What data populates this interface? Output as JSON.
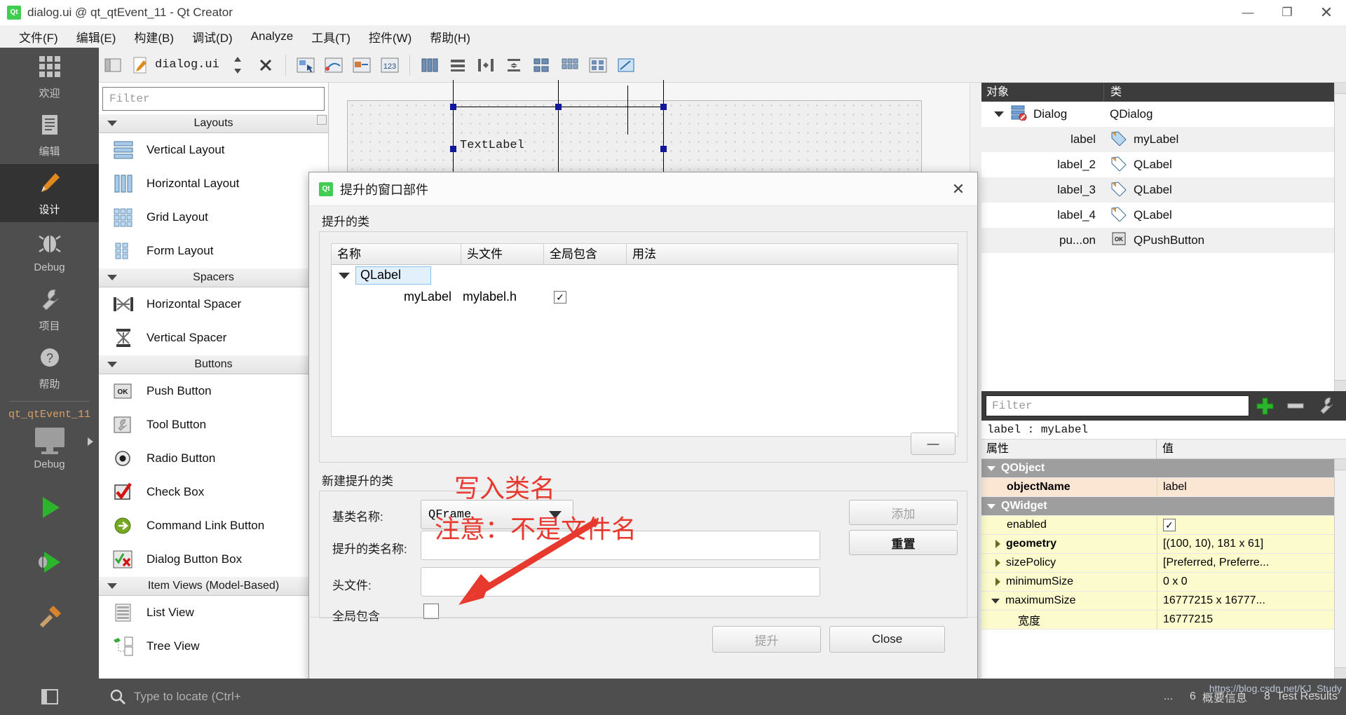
{
  "window": {
    "title": "dialog.ui @ qt_qtEvent_11 - Qt Creator",
    "app_icon": "qt-logo-icon",
    "minimize": "—",
    "maximize": "❐",
    "close": "✕"
  },
  "menubar": {
    "items": [
      {
        "label": "文件(F)",
        "name": "menu-file"
      },
      {
        "label": "编辑(E)",
        "name": "menu-edit"
      },
      {
        "label": "构建(B)",
        "name": "menu-build"
      },
      {
        "label": "调试(D)",
        "name": "menu-debug"
      },
      {
        "label": "Analyze",
        "name": "menu-analyze"
      },
      {
        "label": "工具(T)",
        "name": "menu-tools"
      },
      {
        "label": "控件(W)",
        "name": "menu-window"
      },
      {
        "label": "帮助(H)",
        "name": "menu-help"
      }
    ]
  },
  "modebar": {
    "modes": [
      {
        "label": "欢迎",
        "icon": "grid-icon",
        "active": false
      },
      {
        "label": "编辑",
        "icon": "document-icon",
        "active": false
      },
      {
        "label": "设计",
        "icon": "pencil-icon",
        "active": true
      },
      {
        "label": "Debug",
        "icon": "bug-icon",
        "active": false
      },
      {
        "label": "项目",
        "icon": "wrench-icon",
        "active": false
      },
      {
        "label": "帮助",
        "icon": "question-icon",
        "active": false
      }
    ],
    "project_name": "qt_qtEvent_11",
    "kit_label": "Debug",
    "run_button": "run-icon",
    "debug_button": "debug-run-icon",
    "build_button": "hammer-icon"
  },
  "designer_toolbar": {
    "file_name": "dialog.ui",
    "back_icon": "panel-icon",
    "edit_icon": "pencil-doc-icon",
    "split_icon": "split-icon",
    "close_icon": "close-file-icon",
    "tools": [
      "edit-widgets-icon",
      "edit-signals-icon",
      "edit-buddies-icon",
      "edit-taborder-icon",
      "layout-horizontal-icon",
      "layout-vertical-icon",
      "layout-splitter-h-icon",
      "layout-splitter-v-icon",
      "layout-form-icon",
      "layout-grid-icon",
      "break-layout-icon",
      "adjust-size-icon"
    ]
  },
  "widgetbox": {
    "filter_placeholder": "Filter",
    "sections": [
      {
        "title": "Layouts",
        "items": [
          {
            "label": "Vertical Layout",
            "icon": "vertical-layout-icon"
          },
          {
            "label": "Horizontal Layout",
            "icon": "horizontal-layout-icon"
          },
          {
            "label": "Grid Layout",
            "icon": "grid-layout-icon"
          },
          {
            "label": "Form Layout",
            "icon": "form-layout-icon"
          }
        ]
      },
      {
        "title": "Spacers",
        "items": [
          {
            "label": "Horizontal Spacer",
            "icon": "horizontal-spacer-icon"
          },
          {
            "label": "Vertical Spacer",
            "icon": "vertical-spacer-icon"
          }
        ]
      },
      {
        "title": "Buttons",
        "items": [
          {
            "label": "Push Button",
            "icon": "push-button-icon"
          },
          {
            "label": "Tool Button",
            "icon": "tool-button-icon"
          },
          {
            "label": "Radio Button",
            "icon": "radio-button-icon"
          },
          {
            "label": "Check Box",
            "icon": "check-box-icon"
          },
          {
            "label": "Command Link Button",
            "icon": "command-link-icon"
          },
          {
            "label": "Dialog Button Box",
            "icon": "dialog-button-box-icon"
          }
        ]
      },
      {
        "title": "Item Views (Model-Based)",
        "items": [
          {
            "label": "List View",
            "icon": "list-view-icon"
          },
          {
            "label": "Tree View",
            "icon": "tree-view-icon"
          }
        ]
      }
    ]
  },
  "canvas": {
    "widget_text": "TextLabel"
  },
  "object_inspector": {
    "columns": [
      "对象",
      "类"
    ],
    "rows": [
      {
        "name": "Dialog",
        "class": "QDialog",
        "icon": "dialog-icon",
        "level": 0,
        "expanded": true
      },
      {
        "name": "label",
        "class": "myLabel",
        "icon": "label-icon",
        "level": 1
      },
      {
        "name": "label_2",
        "class": "QLabel",
        "icon": "label-icon",
        "level": 1
      },
      {
        "name": "label_3",
        "class": "QLabel",
        "icon": "label-icon",
        "level": 1
      },
      {
        "name": "label_4",
        "class": "QLabel",
        "icon": "label-icon",
        "level": 1
      },
      {
        "name": "pu...on",
        "class": "QPushButton",
        "icon": "pushbutton-icon",
        "level": 1
      }
    ]
  },
  "property_editor": {
    "filter_placeholder": "Filter",
    "add_button": "plus-icon",
    "remove_button": "minus-icon",
    "configure_button": "wrench-icon",
    "subject": "label : myLabel",
    "columns": [
      "属性",
      "值"
    ],
    "rows": [
      {
        "key": "QObject",
        "value": "",
        "kind": "group"
      },
      {
        "key": "objectName",
        "value": "label",
        "kind": "orange",
        "bold": true
      },
      {
        "key": "QWidget",
        "value": "",
        "kind": "group"
      },
      {
        "key": "enabled",
        "value": "✓",
        "kind": "yellow",
        "checkbox": true
      },
      {
        "key": "geometry",
        "value": "[(100, 10), 181 x 61]",
        "kind": "yellow",
        "bold": true,
        "caret": "right"
      },
      {
        "key": "sizePolicy",
        "value": "[Preferred, Preferre...",
        "kind": "yellow",
        "caret": "right"
      },
      {
        "key": "minimumSize",
        "value": "0 x 0",
        "kind": "yellow",
        "caret": "right"
      },
      {
        "key": "maximumSize",
        "value": "16777215 x 16777...",
        "kind": "yellow",
        "caret": "down"
      },
      {
        "key": "宽度",
        "value": "16777215",
        "kind": "yellow",
        "indent": true
      }
    ]
  },
  "dialog": {
    "title": "提升的窗口部件",
    "icon": "qt-logo-icon",
    "close": "✕",
    "section_promoted": "提升的类",
    "section_new": "新建提升的类",
    "table": {
      "columns": [
        "名称",
        "头文件",
        "全局包含",
        "用法"
      ],
      "rows": [
        {
          "name": "QLabel",
          "header": "",
          "global": "",
          "usage": "",
          "level": 0,
          "selected": true,
          "expanded": true
        },
        {
          "name": "myLabel",
          "header": "mylabel.h",
          "global": "✓",
          "usage": "",
          "level": 1
        }
      ]
    },
    "remove_button": "—",
    "fields": {
      "base_class_label": "基类名称:",
      "base_class_value": "QFrame",
      "promoted_class_label": "提升的类名称:",
      "promoted_class_value": "",
      "header_file_label": "头文件:",
      "header_file_value": "",
      "global_include_label": "全局包含",
      "global_include_checked": false
    },
    "buttons": {
      "add": "添加",
      "reset": "重置",
      "promote": "提升",
      "close": "Close"
    }
  },
  "annotation": {
    "line1": "写入类名",
    "line2": "注意：不是文件名",
    "arrow_color": "#e8392e"
  },
  "statusbar": {
    "locate_placeholder": "Type to locate (Ctrl+",
    "search_icon": "magnifier-icon",
    "overflow": "...",
    "items": [
      {
        "num": "6",
        "label": "概要信息"
      },
      {
        "num": "8",
        "label": "Test Results"
      }
    ]
  },
  "watermark": "https://blog.csdn.net/KJ_Study",
  "colors": {
    "accent_green": "#41cd52",
    "dark_chrome": "#4e4e4e",
    "mode_active": "#333333",
    "annotation_red": "#e8392e",
    "prop_yellow": "#fbfbcd",
    "prop_orange": "#fbe6d4",
    "group_gray": "#9e9e9e",
    "selection_blue": "#10179b"
  }
}
